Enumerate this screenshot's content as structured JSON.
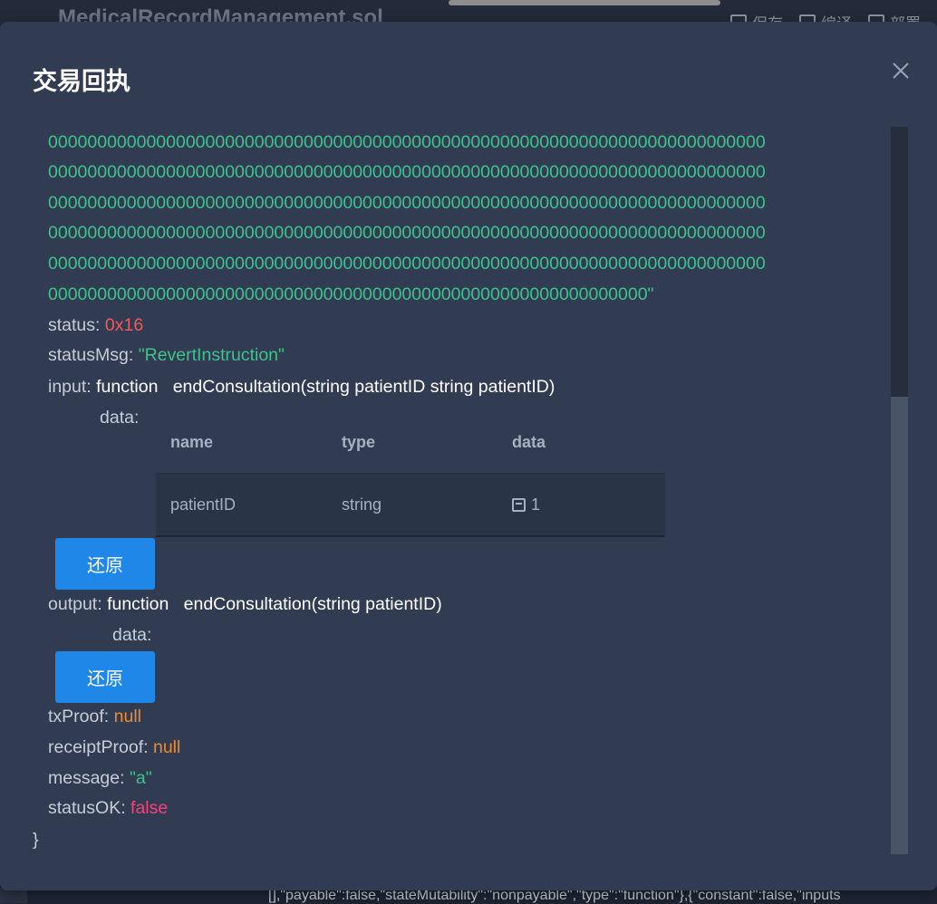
{
  "background": {
    "file_title": "MedicalRecordManagement.sol",
    "tools": [
      {
        "icon": "save-icon",
        "label": "保存"
      },
      {
        "icon": "compile-icon",
        "label": "编译"
      },
      {
        "icon": "deploy-icon",
        "label": "部署"
      }
    ],
    "bottom_text": "[],\"payable\":false,\"stateMutability\":\"nonpayable\",\"type\":\"function\"},{\"constant\":false,\"inputs"
  },
  "modal": {
    "title": "交易回执",
    "close_icon": "close-icon",
    "hex_lines": [
      "0000000000000000000000000000000000000000000000000000000000000000000000000",
      "0000000000000000000000000000000000000000000000000000000000000000000000000",
      "0000000000000000000000000000000000000000000000000000000000000000000000000",
      "0000000000000000000000000000000000000000000000000000000000000000000000000",
      "0000000000000000000000000000000000000000000000000000000000000000000000000",
      "0000000000000000000000000000000000000000000000000000000000000\""
    ],
    "status": {
      "key": "status: ",
      "value": "0x16"
    },
    "statusMsg": {
      "key": "statusMsg: ",
      "value": "\"RevertInstruction\""
    },
    "input": {
      "key": "input: ",
      "keyword": "function",
      "signature": "endConsultation(string patientID string patientID)",
      "data_label": "data:",
      "columns": [
        "name",
        "type",
        "data"
      ],
      "rows": [
        {
          "name": "patientID",
          "type": "string",
          "data": "1",
          "data_icon": "save-icon"
        }
      ],
      "restore_label": "还原"
    },
    "output": {
      "key": "output: ",
      "keyword": "function",
      "signature": "endConsultation(string patientID)",
      "data_label": "data:",
      "restore_label": "还原"
    },
    "txProof": {
      "key": "txProof: ",
      "value": "null"
    },
    "receiptProof": {
      "key": "receiptProof: ",
      "value": "null"
    },
    "message": {
      "key": "message: ",
      "value": "\"a\""
    },
    "statusOK": {
      "key": "statusOK: ",
      "value": "false"
    },
    "closing_brace": "}"
  },
  "colors": {
    "modal_bg": "#313c52",
    "hex_green": "#3ec28b",
    "status_red": "#f0585f",
    "null_orange": "#ef8a31",
    "false_pink": "#f5417a",
    "button_blue": "#1f87e8"
  }
}
